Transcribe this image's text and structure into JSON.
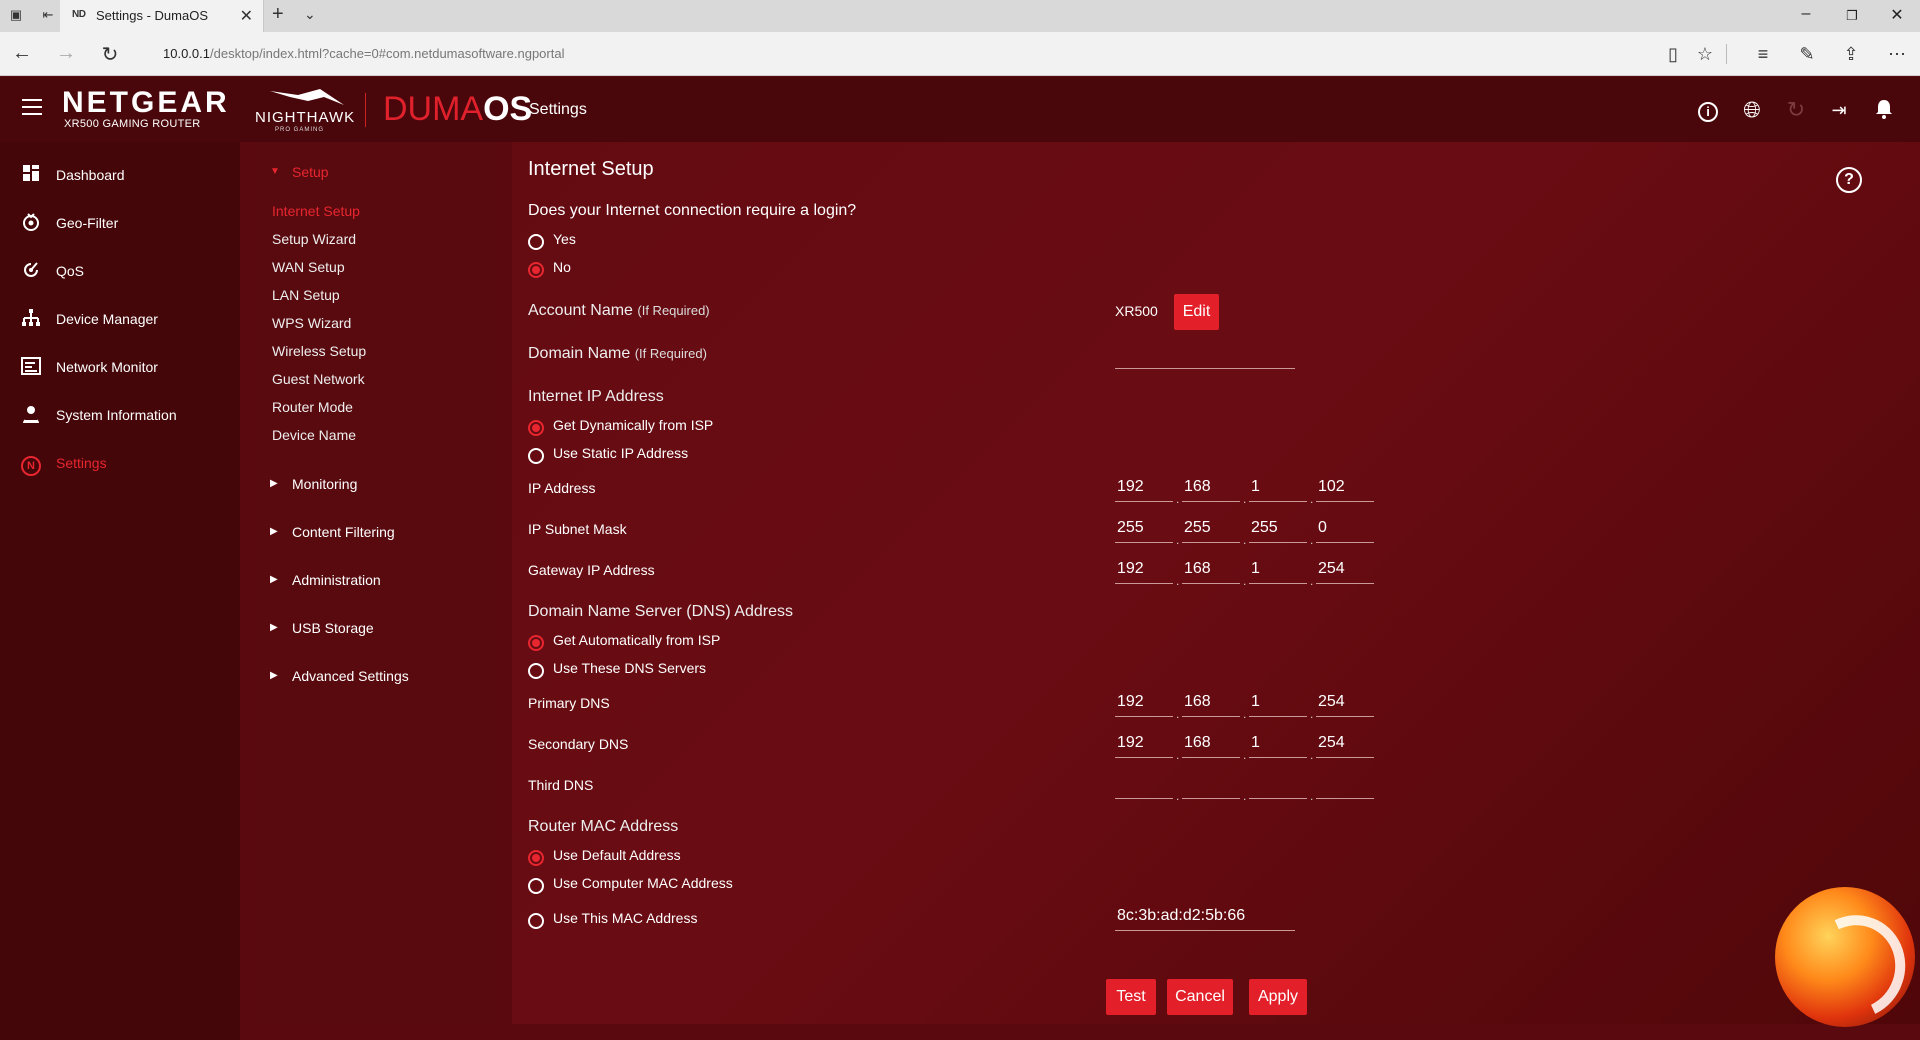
{
  "browser": {
    "tab_title": "Settings - DumaOS",
    "tab_favicon": "ND",
    "url_host": "10.0.0.1",
    "url_path": "/desktop/index.html?cache=0#com.netdumasoftware.ngportal"
  },
  "header": {
    "brand": "NETGEAR",
    "brand_sub": "XR500 GAMING ROUTER",
    "nighthawk": "NIGHTHAWK",
    "nighthawk_sub": "PRO GAMING",
    "duma_a": "DUMA",
    "duma_b": "OS",
    "page": "Settings",
    "icons": [
      "info-icon",
      "globe-icon",
      "refresh-icon",
      "logout-icon",
      "bell-icon"
    ]
  },
  "sidebar": {
    "items": [
      {
        "label": "Dashboard",
        "icon": "dashboard-icon"
      },
      {
        "label": "Geo-Filter",
        "icon": "geo-filter-icon"
      },
      {
        "label": "QoS",
        "icon": "qos-icon"
      },
      {
        "label": "Device Manager",
        "icon": "device-manager-icon"
      },
      {
        "label": "Network Monitor",
        "icon": "network-monitor-icon"
      },
      {
        "label": "System Information",
        "icon": "system-information-icon"
      },
      {
        "label": "Settings",
        "icon": "settings-icon",
        "active": true
      }
    ]
  },
  "subnav": {
    "setup_label": "Setup",
    "setup_links": [
      "Internet Setup",
      "Setup Wizard",
      "WAN Setup",
      "LAN Setup",
      "WPS Wizard",
      "Wireless Setup",
      "Guest Network",
      "Router Mode",
      "Device Name"
    ],
    "sections": [
      "Monitoring",
      "Content Filtering",
      "Administration",
      "USB Storage",
      "Advanced Settings"
    ]
  },
  "main": {
    "title": "Internet Setup",
    "login_question": "Does your Internet connection require a login?",
    "login_yes": "Yes",
    "login_no": "No",
    "account_label": "Account Name",
    "if_required": "(If Required)",
    "account_value": "XR500",
    "edit_label": "Edit",
    "domain_label": "Domain Name",
    "domain_value": "",
    "ip_section": "Internet IP Address",
    "ip_dynamic": "Get Dynamically from ISP",
    "ip_static": "Use Static IP Address",
    "ip_label": "IP Address",
    "ip_values": [
      "192",
      "168",
      "1",
      "102"
    ],
    "subnet_label": "IP Subnet Mask",
    "subnet_values": [
      "255",
      "255",
      "255",
      "0"
    ],
    "gateway_label": "Gateway IP Address",
    "gateway_values": [
      "192",
      "168",
      "1",
      "254"
    ],
    "dns_section": "Domain Name Server (DNS) Address",
    "dns_auto": "Get Automatically from ISP",
    "dns_manual": "Use These DNS Servers",
    "primary_dns_label": "Primary DNS",
    "primary_dns_values": [
      "192",
      "168",
      "1",
      "254"
    ],
    "secondary_dns_label": "Secondary DNS",
    "secondary_dns_values": [
      "192",
      "168",
      "1",
      "254"
    ],
    "third_dns_label": "Third DNS",
    "third_dns_values": [
      "",
      "",
      "",
      ""
    ],
    "mac_section": "Router MAC Address",
    "mac_default": "Use Default Address",
    "mac_computer": "Use Computer MAC Address",
    "mac_this": "Use This MAC Address",
    "mac_value": "8c:3b:ad:d2:5b:66",
    "test_label": "Test",
    "cancel_label": "Cancel",
    "apply_label": "Apply"
  },
  "colors": {
    "accent": "#e3202a",
    "background": "#5a0a0e"
  }
}
